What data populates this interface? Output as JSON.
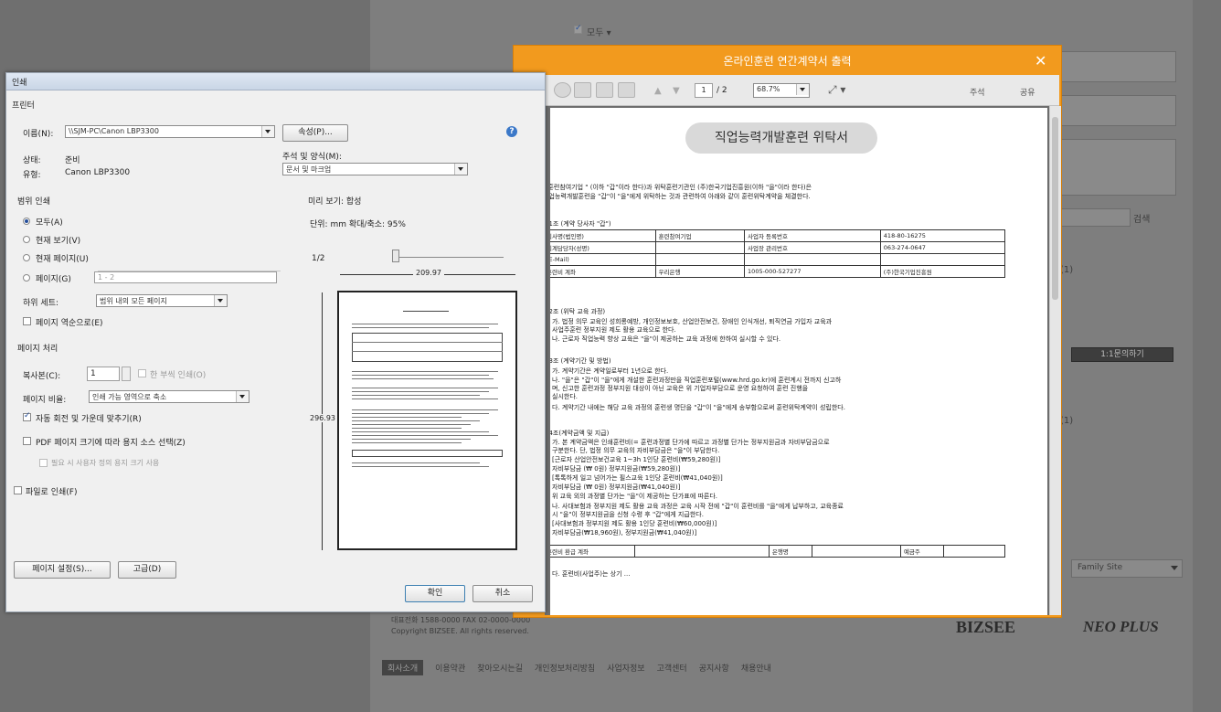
{
  "background": {
    "top_checkbox_label": "모두 ▾",
    "lower_buttons": [
      "1:1문의하기"
    ],
    "side_buttons": [
      "검색"
    ],
    "right_text": "(1)",
    "family_select": "Family Site",
    "copyright_lines": [
      "대표전화 1588-0000   FAX 02-0000-0000",
      "Copyright BIZSEE. All rights reserved."
    ],
    "logos": [
      "BIZSEE",
      "NEO PLUS"
    ],
    "footer_nav": [
      "회사소개",
      "이용약관",
      "찾아오시는길",
      "개인정보처리방침",
      "사업자정보",
      "고객센터",
      "공지사항",
      "채용안내"
    ]
  },
  "print_dialog": {
    "title": "인쇄",
    "printer_section": "프린터",
    "name_label": "이름(N):",
    "printer_name": "\\\\SJM-PC\\Canon LBP3300",
    "properties_button": "속성(P)...",
    "status_label": "상태:",
    "status_value": "준비",
    "type_label": "유형:",
    "type_value": "Canon LBP3300",
    "comments_label": "주석 및 양식(M):",
    "comments_value": "문서 및 마크업",
    "range_section": "범위 인쇄",
    "range_options": [
      "모두(A)",
      "현재 보기(V)",
      "현재 페이지(U)",
      "페이지(G)"
    ],
    "range_selected": 0,
    "pages_value": "1 - 2",
    "subset_label": "하위 세트:",
    "subset_value": "범위 내의 모든 페이지",
    "reverse_label": "페이지 역순으로(E)",
    "handling_section": "페이지 처리",
    "copies_label": "복사본(C):",
    "copies_value": "1",
    "collate_label": "한 부씩 인쇄(O)",
    "scaling_label": "페이지 비율:",
    "scaling_value": "인쇄 가능 영역으로 축소",
    "autorotate_label": "자동 회전 및 가운데 맞추기(R)",
    "pdf_size_label": "PDF 페이지 크기에 따라 용지 소스 선택(Z)",
    "custom_paper_label": "필요 시 사용자 정의 용지 크기 사용",
    "print_to_file_label": "파일로 인쇄(F)",
    "preview_section": "미리 보기: 합성",
    "units_text": "단위: mm 확대/축소: 95%",
    "page_indicator": "1/2",
    "width_dim": "209.97",
    "height_dim": "296.93",
    "page_setup_button": "페이지 설정(S)...",
    "advanced_button": "고급(D)",
    "ok_button": "확인",
    "cancel_button": "취소"
  },
  "pdf_viewer": {
    "title": "온라인훈련 연간계약서 출력",
    "close_glyph": "✕",
    "page_current": "1",
    "page_total": "/ 2",
    "zoom": "68.7%",
    "comment_link": "주석",
    "share_link": "공유",
    "doc_title": "직업능력개발훈련 위탁서",
    "intro_lines": [
      "\" 훈련참여기업 \" (이하 \"갑\"이라 한다)과 위탁훈련기관인 (주)한국기업진흥원(이하 \"을\"이라 한다)은",
      "직업능력개발훈련을 \"갑\"이 \"을\"에게 위탁하는 것과 관련하여 아래와 같이 훈련위탁계약을 체결한다."
    ],
    "clause1_heading": "제1조 (계약 당사자 \"갑\")",
    "party_table": [
      [
        "회사명(법인명)",
        "훈련참여기업",
        "사업자 등록번호",
        "418-80-16275"
      ],
      [
        "회계담당자(성명)",
        "",
        "사업장 관리번호",
        "063-274-0647"
      ],
      [
        "(E-Mail)",
        "",
        "",
        ""
      ],
      [
        "훈련비 계좌",
        "우리은행",
        "1005-000-527277",
        "(주)한국기업진흥원"
      ]
    ],
    "clause2_heading": "제2조 (위탁 교육 과정)",
    "clause2_lines": [
      "가. 법정 의무 교육인 성희롱예방, 개인정보보호, 산업안전보건, 장애인 인식개선, 퇴직연금 가입자 교육과",
      "    사업주훈련 정부지원 제도 활용 교육으로 한다.",
      "나. 근로자 직업능력 향상 교육은 \"을\"이 제공하는 교육 과정에 한하여 실시할 수 있다."
    ],
    "clause3_heading": "제3조 (계약기간 및 방법)",
    "clause3_lines": [
      "가. 계약기간은 계약일로부터 1년으로 한다.",
      "나. \"을\"은 \"갑\"이 \"을\"에게 개설한 훈련과정만을 직업훈련포털(www.hrd.go.kr)에 훈련계시 전까지 신고하",
      "    며, 신고한 훈련과정 정부지원 대상이 아닌 교육은 위 기업자부담으로 운영 요청하여 훈련 진행을",
      "    실시한다.",
      "다. 계약기간 내에는 해당 교육 과정의 훈련생 명단을 \"갑\"이 \"을\"에게 송부함으로써 훈련위탁계약이 성립한다."
    ],
    "clause4_heading": "제4조(계약금액 및 지급)",
    "clause4_lines": [
      "가. 본 계약금액은 인쇄훈련비(= 훈련과정별 단가에 따르고 과정별 단가는 정부지원금과 자비부담금으로",
      "    구분한다. 단, 법정 의무 교육의 자비부담금은 \"을\"이 부담한다.",
      "    [근로자 산업안전보건교육 1~3h 1인당 훈련비(₩59,280원)]",
      "                              자비부담금 (₩       0원) 정부지원금(₩59,280원)]",
      "    [톡톡하게 일고 넘어가는 필스교육 1인당 훈련비(₩41,040원)]",
      "                              자비부담금 (₩       0원)  정부지원금(₩41,040원)]",
      "    위 교육 외의 과정별 단가는 \"을\"이 제공하는 단가표에 따른다.",
      "나. 사대보험과 정부지원 제도 활용 교육 과정은 교육 시작 전에 \"갑\"이 훈련비를 \"을\"에게 납부하고, 교육종료",
      "    시 \"을\"이 정부지원금을 신청 수령 후 \"갑\"에게 지급한다.",
      "    [사대보험과 정부지원 제도 활용 1인당 훈련비(₩60,000원)]",
      "                              자비부담금(₩18,960원), 정부지원금(₩41,040원)]"
    ],
    "refund_table": [
      "훈련비 환급 계좌",
      "",
      "은행명",
      "",
      "예금주",
      ""
    ],
    "bottom_line": "다. 훈련비(사업주)는 상기 ..."
  }
}
